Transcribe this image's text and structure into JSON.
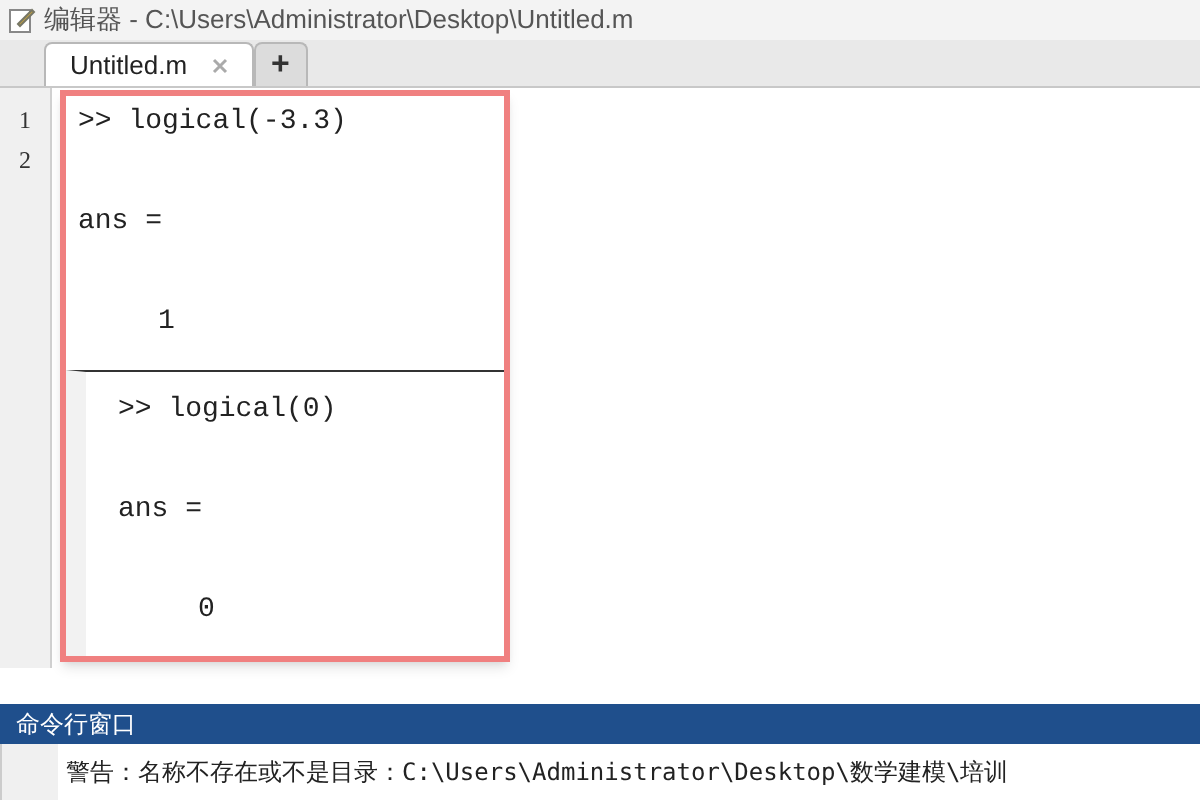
{
  "window": {
    "title": "编辑器 - C:\\Users\\Administrator\\Desktop\\Untitled.m"
  },
  "tabs": [
    {
      "label": "Untitled.m",
      "selected": true,
      "closable": true
    },
    {
      "label": "+",
      "selected": false,
      "closable": false
    }
  ],
  "editor": {
    "line_numbers": [
      "1",
      "2"
    ]
  },
  "snippets": [
    {
      "command": ">> logical(-3.3)",
      "result_label": "ans =",
      "value": "1"
    },
    {
      "command": ">> logical(0)",
      "result_label": "ans =",
      "value": "0"
    }
  ],
  "command_window": {
    "title": "命令行窗口",
    "lines": [
      "警告：名称不存在或不是目录：C:\\Users\\Administrator\\Desktop\\数学建模\\培训"
    ]
  }
}
